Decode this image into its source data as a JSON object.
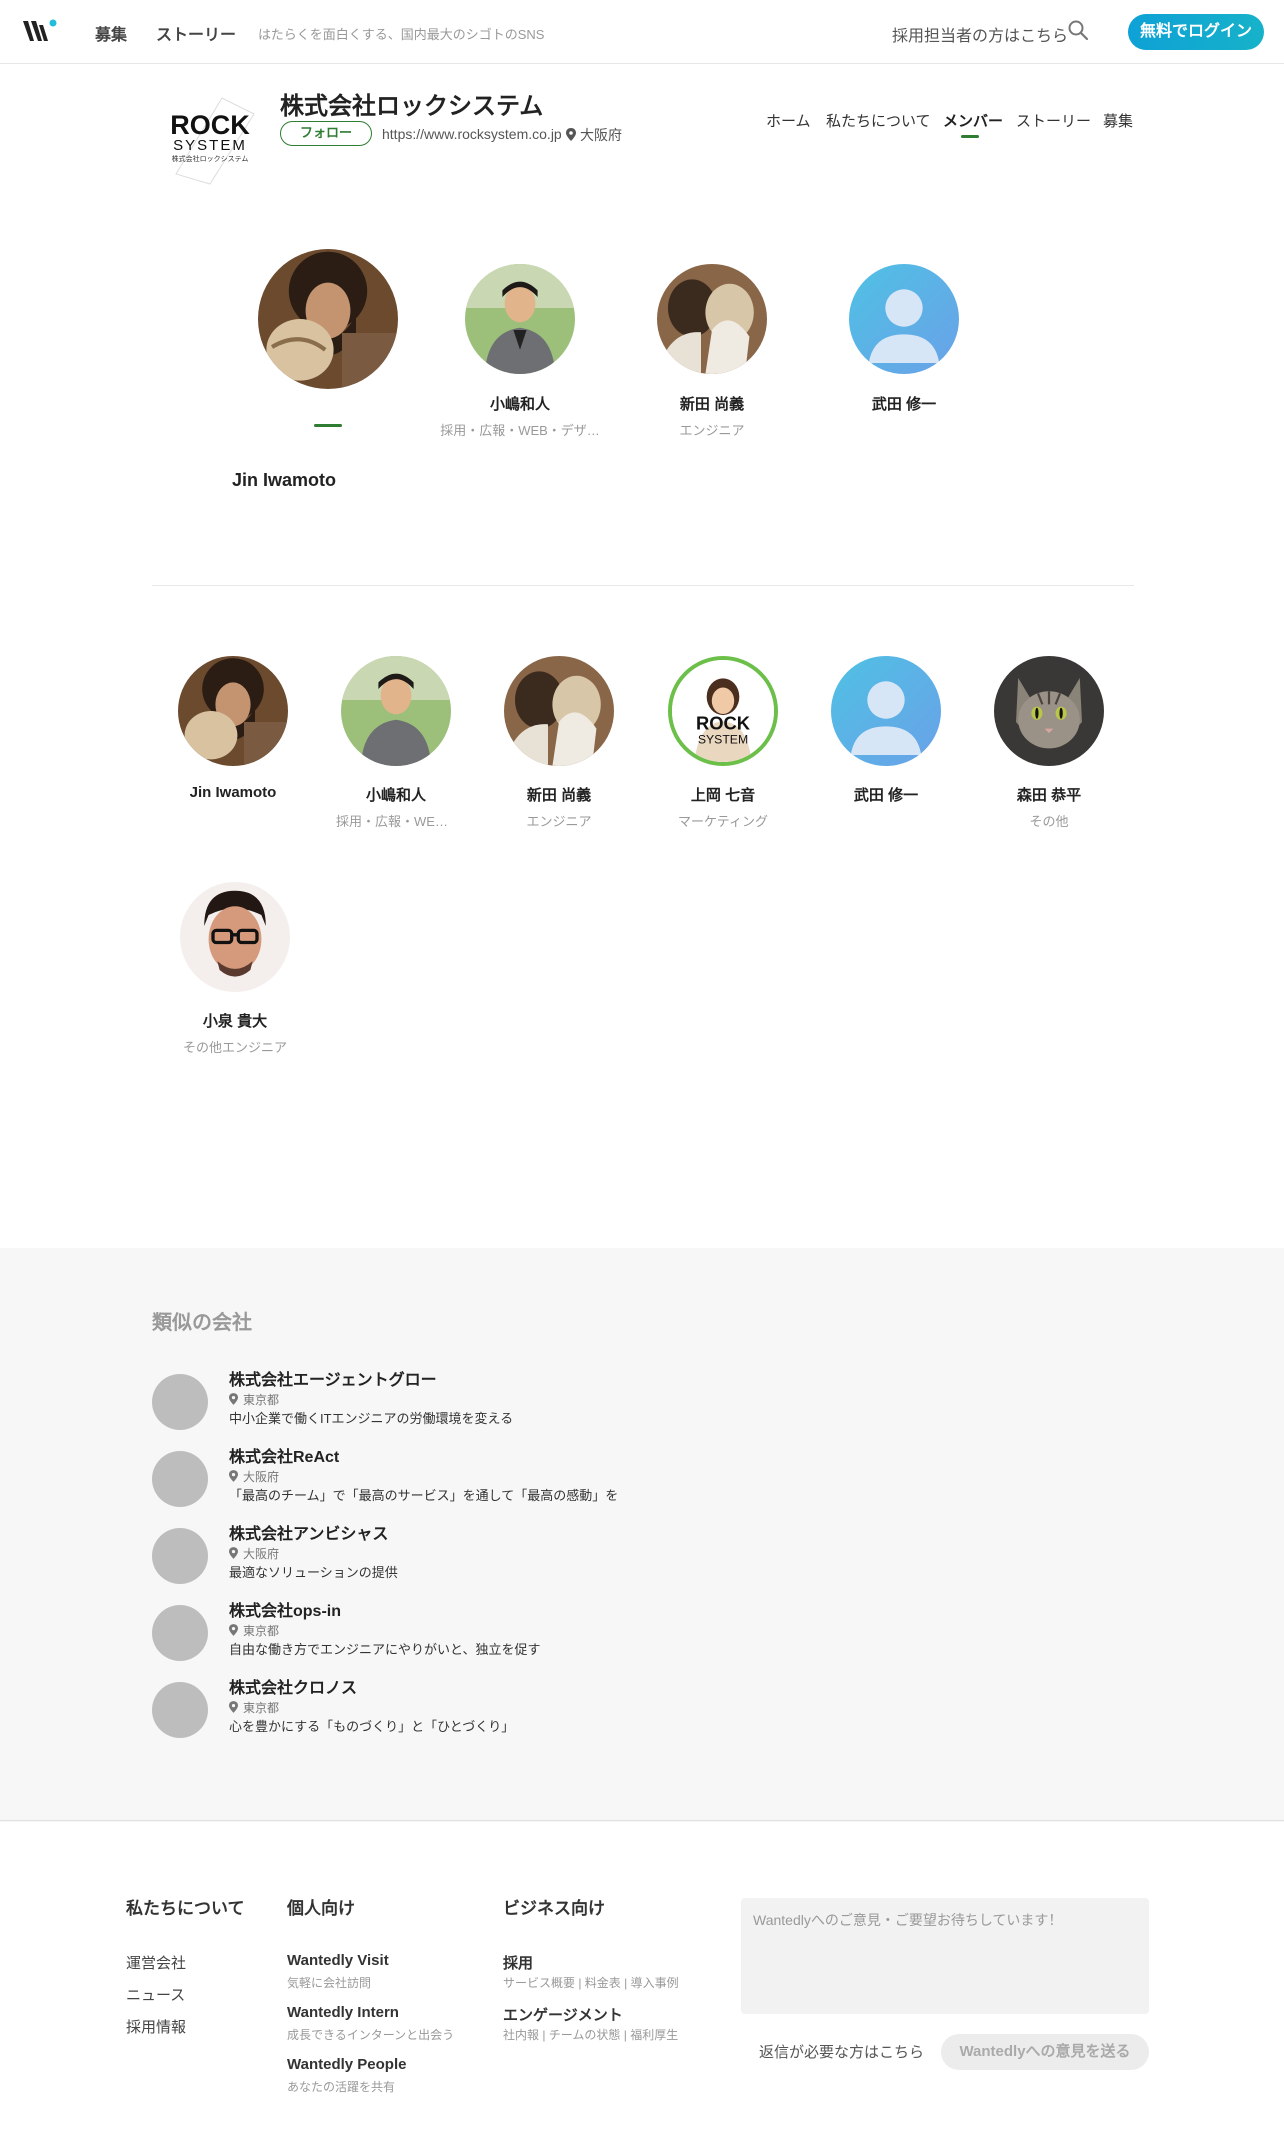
{
  "header": {
    "nav": [
      "募集",
      "ストーリー"
    ],
    "tagline": "はたらくを面白くする、国内最大のシゴトのSNS",
    "recruiter_link": "採用担当者の方はこちら",
    "login_button": "無料でログイン",
    "brand_color": "#14a8cf"
  },
  "company": {
    "name": "株式会社ロックシステム",
    "follow_button": "フォロー",
    "url": "https://www.rocksystem.co.jp",
    "location": "大阪府",
    "logo_text": [
      "ROCK",
      "SYSTEM",
      "株式会社ロックシステム"
    ],
    "tabs": [
      "ホーム",
      "私たちについて",
      "メンバー",
      "ストーリー",
      "募集"
    ],
    "active_tab": "メンバー",
    "accent_color": "#2e7d32"
  },
  "featured_members": [
    {
      "name": "",
      "role": "",
      "selected": true
    },
    {
      "name": "小嶋和人",
      "role": "採用・広報・WEB・デザ…"
    },
    {
      "name": "新田 尚義",
      "role": "エンジニア"
    },
    {
      "name": "武田 修一",
      "role": ""
    }
  ],
  "selected_member_name": "Jin Iwamoto",
  "members": [
    {
      "name": "Jin Iwamoto",
      "role": ""
    },
    {
      "name": "小嶋和人",
      "role": "採用・広報・WEB…"
    },
    {
      "name": "新田 尚義",
      "role": "エンジニア"
    },
    {
      "name": "上岡 七音",
      "role": "マーケティング",
      "avatar_text": [
        "ROCK",
        "SYSTEM"
      ]
    },
    {
      "name": "武田 修一",
      "role": ""
    },
    {
      "name": "森田 恭平",
      "role": "その他"
    },
    {
      "name": "小泉 貴大",
      "role": "その他エンジニア"
    }
  ],
  "similar": {
    "title": "類似の会社",
    "companies": [
      {
        "name": "株式会社エージェントグロー",
        "location": "東京都",
        "desc": "中小企業で働くITエンジニアの労働環境を変える"
      },
      {
        "name": "株式会社ReAct",
        "location": "大阪府",
        "desc": "「最高のチーム」で「最高のサービス」を通して「最高の感動」を"
      },
      {
        "name": "株式会社アンビシャス",
        "location": "大阪府",
        "desc": "最適なソリューションの提供"
      },
      {
        "name": "株式会社ops-in",
        "location": "東京都",
        "desc": "自由な働き方でエンジニアにやりがいと、独立を促す"
      },
      {
        "name": "株式会社クロノス",
        "location": "東京都",
        "desc": "心を豊かにする「ものづくり」と「ひとづくり」"
      }
    ]
  },
  "footer": {
    "about": {
      "heading": "私たちについて",
      "links": [
        "運営会社",
        "ニュース",
        "採用情報"
      ]
    },
    "personal": {
      "heading": "個人向け",
      "items": [
        {
          "title": "Wantedly Visit",
          "sub": "気軽に会社訪問"
        },
        {
          "title": "Wantedly Intern",
          "sub": "成長できるインターンと出会う"
        },
        {
          "title": "Wantedly People",
          "sub": "あなたの活躍を共有"
        }
      ]
    },
    "business": {
      "heading": "ビジネス向け",
      "items": [
        {
          "title": "採用",
          "sub": "サービス概要 | 料金表 | 導入事例"
        },
        {
          "title": "エンゲージメント",
          "sub": "社内報 | チームの状態 | 福利厚生"
        }
      ]
    },
    "feedback_placeholder": "Wantedlyへのご意見・ご要望お待ちしています！",
    "reply_link": "返信が必要な方はこちら",
    "send_button": "Wantedlyへの意見を送る"
  }
}
